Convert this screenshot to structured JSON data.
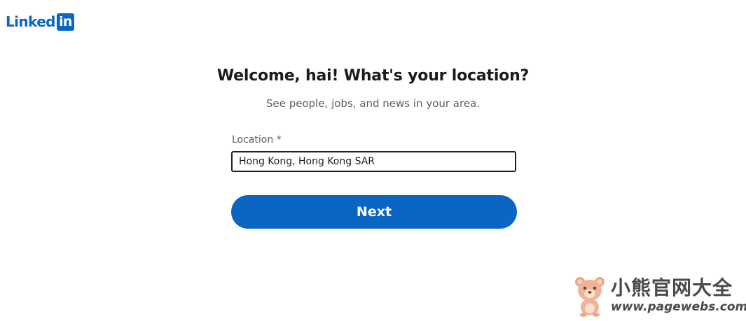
{
  "brand": {
    "logo_word": "Linked",
    "logo_box": "in",
    "color": "#0a66c2"
  },
  "header": {
    "title": "Welcome, hai! What's your location?",
    "subtitle": "See people, jobs, and news in your area."
  },
  "form": {
    "location_label": "Location *",
    "location_value": "Hong Kong, Hong Kong SAR",
    "next_label": "Next"
  },
  "watermark": {
    "text_cn": "小熊官网大全",
    "url": "www.pagewebs.com",
    "icon": "bear-icon"
  }
}
